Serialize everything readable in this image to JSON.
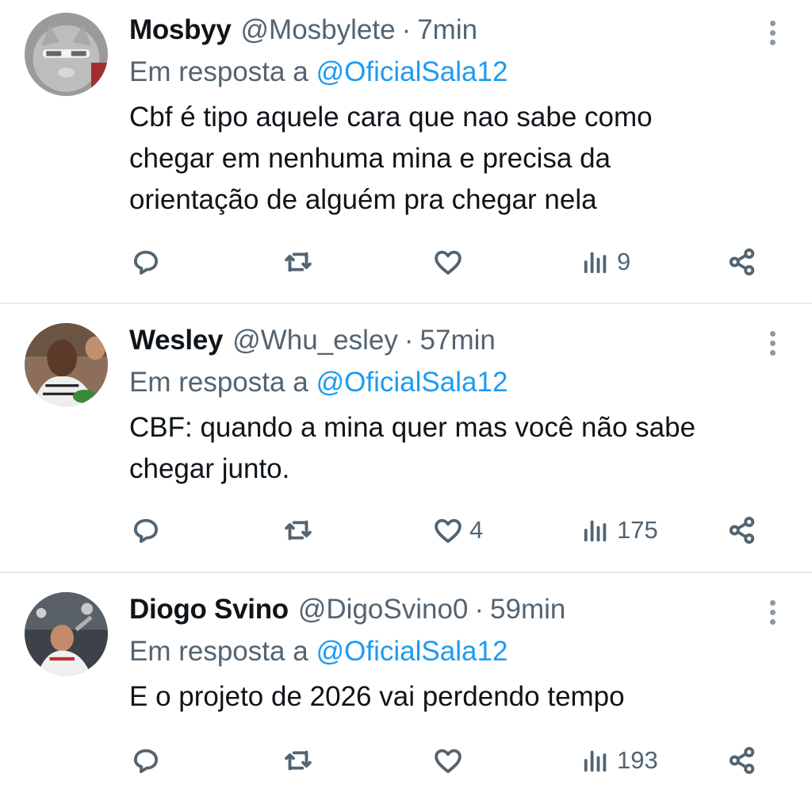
{
  "reply_prefix": "Em resposta a",
  "colors": {
    "link": "#1d9bf0",
    "muted": "#536471",
    "text": "#0f1419",
    "divider": "#e6e9eb"
  },
  "icons": {
    "reply": "chat-bubble-icon",
    "retweet": "retweet-icon",
    "like": "heart-icon",
    "views": "bar-chart-icon",
    "share": "share-icon",
    "more": "vertical-dots-icon"
  },
  "tweets": [
    {
      "name": "Mosbyy",
      "handle": "@Mosbylete",
      "time": "7min",
      "reply_to": "@OficialSala12",
      "text_lines": [
        "Cbf é tipo aquele cara que nao sabe como",
        "chegar em nenhuma mina e precisa da",
        "orientação de alguém pra chegar nela"
      ],
      "likes": "",
      "views": "9"
    },
    {
      "name": "Wesley",
      "handle": "@Whu_esley",
      "time": "57min",
      "reply_to": "@OficialSala12",
      "text_lines": [
        "CBF: quando a mina quer mas você não sabe",
        "chegar junto."
      ],
      "likes": "4",
      "views": "175"
    },
    {
      "name": "Diogo Svino",
      "handle": "@DigoSvino0",
      "time": "59min",
      "reply_to": "@OficialSala12",
      "text_lines": [
        "E o projeto de 2026 vai perdendo tempo"
      ],
      "likes": "",
      "views": "193"
    }
  ]
}
